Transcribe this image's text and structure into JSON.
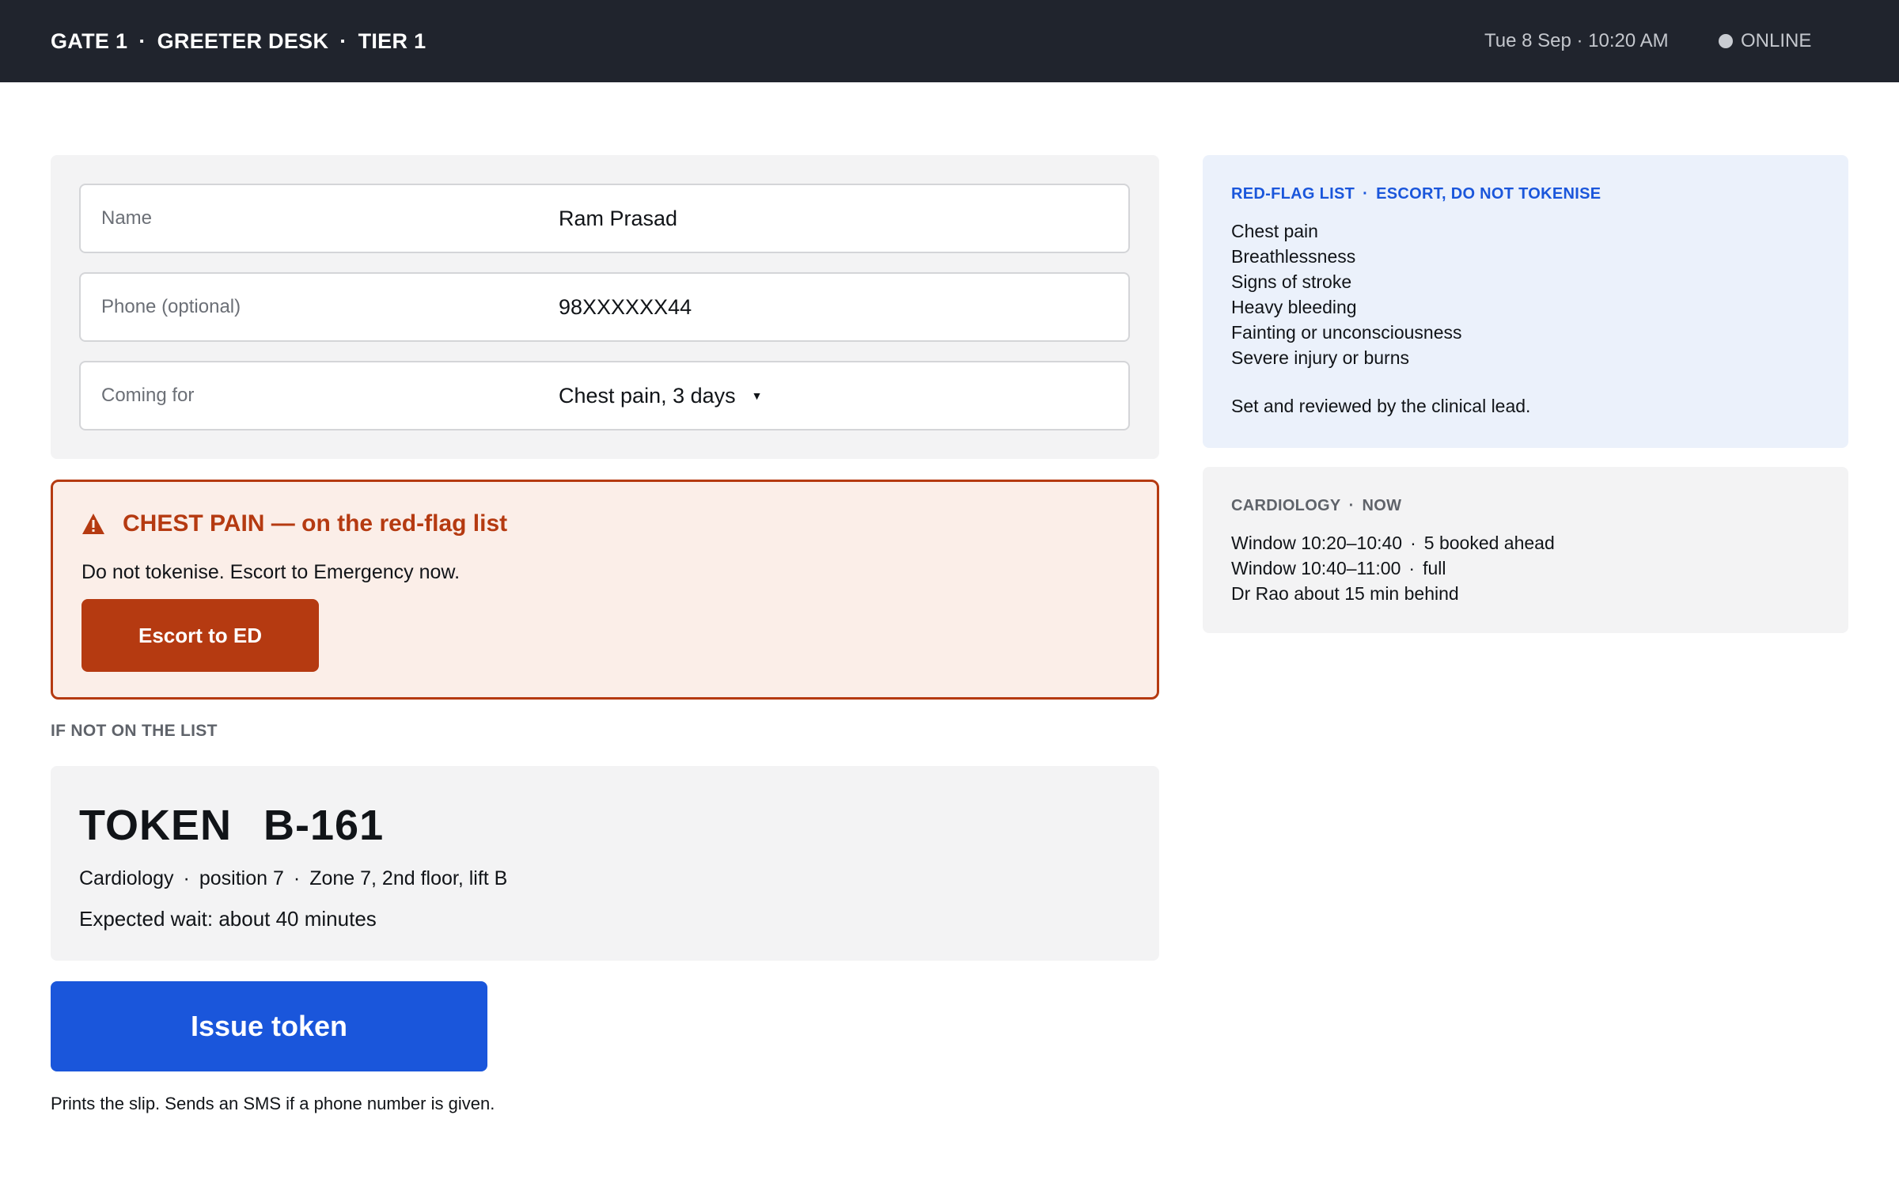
{
  "header": {
    "crumbs": [
      "GATE 1",
      "GREETER DESK",
      "TIER 1"
    ],
    "separator": "·",
    "datetime": "Tue 8 Sep · 10:20 AM",
    "status": "ONLINE"
  },
  "form": {
    "name": {
      "label": "Name",
      "value": "Ram Prasad"
    },
    "phone": {
      "label": "Phone (optional)",
      "value": "98XXXXXX44"
    },
    "reason": {
      "label": "Coming for",
      "value": "Chest pain, 3 days"
    }
  },
  "alert": {
    "title": "CHEST PAIN — on the red-flag list",
    "message": "Do not tokenise. Escort to Emergency now.",
    "button": "Escort to ED"
  },
  "fallback_label": "IF NOT ON THE LIST",
  "token": {
    "word": "TOKEN",
    "number": "B-161",
    "department": "Cardiology",
    "position": "position 7",
    "location": "Zone 7, 2nd floor, lift B",
    "wait": "Expected wait: about 40 minutes"
  },
  "issue": {
    "button": "Issue token",
    "note": "Prints the slip. Sends an SMS if a phone number is given."
  },
  "redflag": {
    "heading_a": "RED-FLAG LIST",
    "heading_b": "ESCORT, DO NOT TOKENISE",
    "items": [
      "Chest pain",
      "Breathlessness",
      "Signs of stroke",
      "Heavy bleeding",
      "Fainting or unconsciousness",
      "Severe injury or burns"
    ],
    "note": "Set and reviewed by the clinical lead."
  },
  "cardiology": {
    "heading_a": "CARDIOLOGY",
    "heading_b": "NOW",
    "rows": [
      {
        "window": "Window 10:20–10:40",
        "info": "5 booked ahead"
      },
      {
        "window": "Window 10:40–11:00",
        "info": "full"
      }
    ],
    "doctor_note": "Dr Rao about 15 min behind"
  },
  "colors": {
    "topbar": "#20242d",
    "alert_accent": "#b53a11",
    "primary": "#1a56db",
    "panel_blue": "#ebf1fb"
  }
}
